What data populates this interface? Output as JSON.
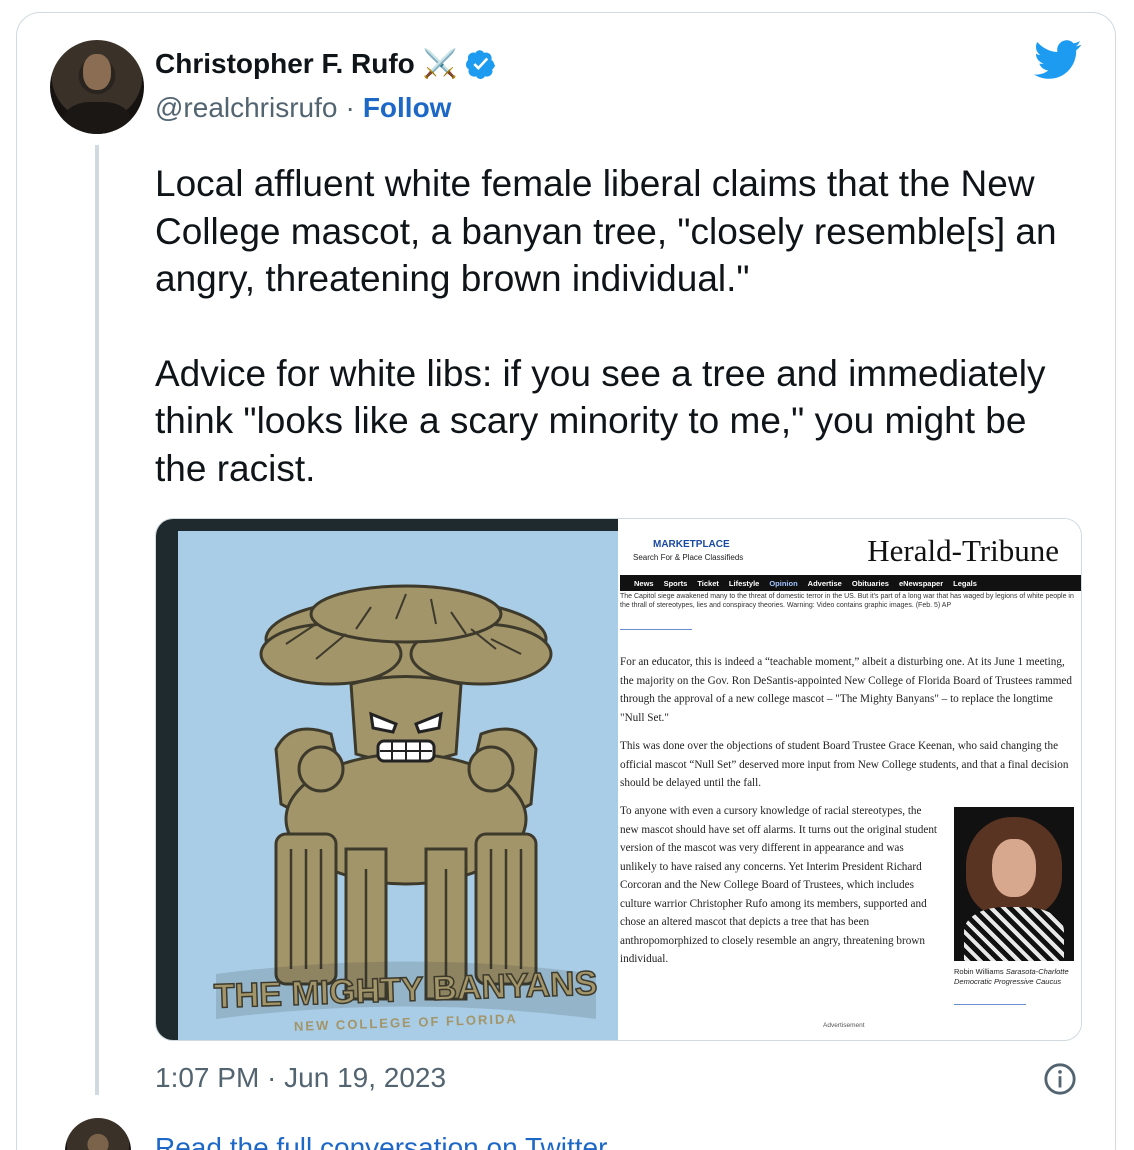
{
  "author": {
    "name": "Christopher F. Rufo",
    "emoji": "⚔️",
    "handle": "@realchrisrufo",
    "separator": "·",
    "follow_label": "Follow"
  },
  "icons": {
    "verified": "verified-badge-icon",
    "bird": "twitter-bird-icon",
    "info": "info-icon",
    "brand_color": "#1d9bf0"
  },
  "tweet": {
    "paragraph1": "Local affluent white female liberal claims that the New College mascot, a banyan tree, \"closely resemble[s] an angry, threatening brown individual.\"",
    "paragraph2": "Advice for white libs: if you see a tree and immediately think \"looks like a scary minority to me,\" you might be the racist."
  },
  "media": {
    "mascot_title": "THE MIGHTY BANYANS",
    "mascot_subtitle": "NEW COLLEGE OF FLORIDA",
    "news": {
      "marketplace": "MARKETPLACE",
      "marketplace_sub": "Search For & Place Classifieds",
      "masthead": "Herald-Tribune",
      "nav": [
        "News",
        "Sports",
        "Ticket",
        "Lifestyle",
        "Opinion",
        "Advertise",
        "Obituaries",
        "eNewspaper",
        "Legals"
      ],
      "caption_top": "The Capitol siege awakened many to the threat of domestic terror in the US. But it's part of a long war that has waged by legions of white people in the thrall of stereotypes, lies and conspiracy theories. Warning: Video contains graphic images. (Feb. 5) AP",
      "p1": "For an educator, this is indeed a “teachable moment,” albeit a disturbing one. At its June 1 meeting, the majority on the Gov. Ron DeSantis-appointed New College of Florida Board of Trustees rammed through the approval of a new college mascot – \"The Mighty Banyans\" – to replace the longtime \"Null Set.\"",
      "p2": "This was done over the objections of student Board Trustee Grace Keenan, who said changing the official mascot “Null Set” deserved more input from New College students, and that a final decision should be delayed until the fall.",
      "p3": "To anyone with even a cursory knowledge of racial stereotypes, the new mascot should have set off alarms. It turns out the original student version of the mascot was very different in appearance and was unlikely to have raised any concerns. Yet Interim President Richard Corcoran and the New College Board of Trustees, which includes culture warrior Christopher Rufo among its members, supported and chose an altered mascot that depicts a tree that has been anthropomorphized to closely resemble an angry, threatening brown individual.",
      "photo_caption_name": "Robin Williams",
      "photo_caption_rest": "Sarasota-Charlotte Democratic Progressive Caucus",
      "advertisement": "Advertisement"
    }
  },
  "timestamp": "1:07 PM · Jun 19, 2023",
  "read_more": "Read the full conversation on Twitter"
}
